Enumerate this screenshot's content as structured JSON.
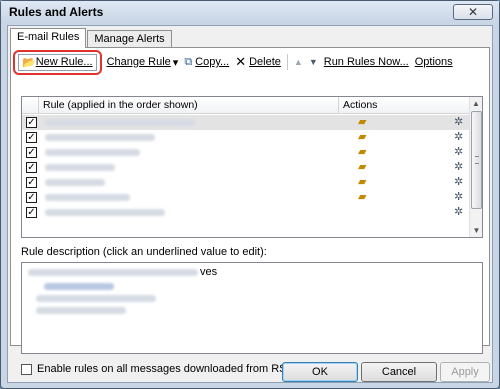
{
  "window": {
    "title": "Rules and Alerts",
    "close_glyph": "✕"
  },
  "tabs": [
    {
      "label": "E-mail Rules",
      "active": true
    },
    {
      "label": "Manage Alerts",
      "active": false
    }
  ],
  "toolbar": {
    "new_rule": "New Rule...",
    "change_rule": "Change Rule",
    "copy": "Copy...",
    "delete": "Delete",
    "move_up_glyph": "▲",
    "move_down_glyph": "▼",
    "run_rules_now": "Run Rules Now...",
    "options": "Options",
    "dropdown_glyph": "▾"
  },
  "rules_list": {
    "col_rule": "Rule (applied in the order shown)",
    "col_actions": "Actions",
    "rows": [
      {
        "checked": true,
        "selected": true
      },
      {
        "checked": true,
        "selected": false
      },
      {
        "checked": true,
        "selected": false
      },
      {
        "checked": true,
        "selected": false
      },
      {
        "checked": true,
        "selected": false
      },
      {
        "checked": true,
        "selected": false
      },
      {
        "checked": true,
        "selected": false
      }
    ]
  },
  "description": {
    "label": "Rule description (click an underlined value to edit):",
    "visible_fragment": "ves"
  },
  "rss": {
    "label": "Enable rules on all messages downloaded from RSS Feeds",
    "checked": false
  },
  "buttons": {
    "ok": "OK",
    "cancel": "Cancel",
    "apply": "Apply"
  },
  "icons": {
    "new_rule": "folder-new-icon",
    "copy": "copy-icon",
    "delete": "delete-x-icon",
    "action_move": "folder-icon",
    "action_more": "wand-icon"
  },
  "colors": {
    "highlight_circle": "#e0332e",
    "selected_row": "#e3e3e3"
  }
}
